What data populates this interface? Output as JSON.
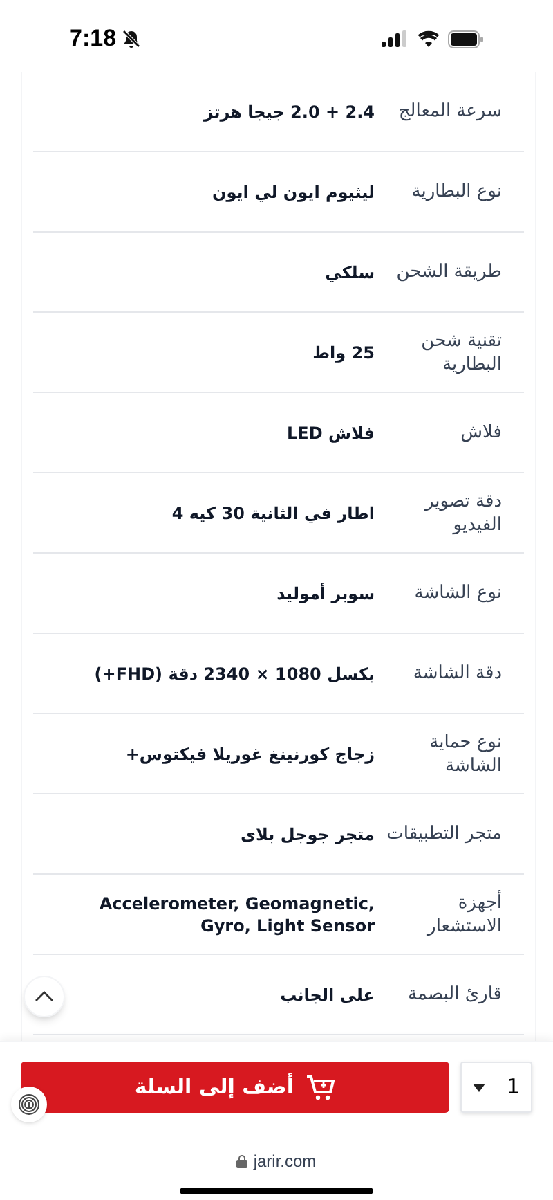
{
  "status_bar": {
    "time": "7:18"
  },
  "specs": [
    {
      "label": "سرعة المعالج",
      "value": "2.4 + 2.0 جيجا هرتز"
    },
    {
      "label": "نوع البطارية",
      "value": "ليثيوم ايون لي ايون"
    },
    {
      "label": "طريقة الشحن",
      "value": "سلكي"
    },
    {
      "label": "تقنية شحن البطارية",
      "value": "25 واط"
    },
    {
      "label": "فلاش",
      "value": "فلاش LED"
    },
    {
      "label": "دقة تصوير الفيديو",
      "value": "اطار في الثانية 30 كيه 4"
    },
    {
      "label": "نوع الشاشة",
      "value": "سوبر أموليد"
    },
    {
      "label": "دقة الشاشة",
      "value": "بكسل 1080 × 2340 دقة (FHD+)"
    },
    {
      "label": "نوع حماية الشاشة",
      "value": "زجاج كورنينغ غوريلا فيكتوس+"
    },
    {
      "label": "متجر التطبيقات",
      "value": "متجر جوجل بلاى"
    },
    {
      "label": "أجهزة الاستشعار",
      "value": "Accelerometer, Geomagnetic, Gyro, Light Sensor"
    },
    {
      "label": "قارئ البصمة",
      "value": "على الجانب"
    }
  ],
  "add_to_cart": {
    "label": "أضف إلى السلة"
  },
  "quantity": {
    "value": "1"
  },
  "address_bar": {
    "url": "jarir.com"
  }
}
